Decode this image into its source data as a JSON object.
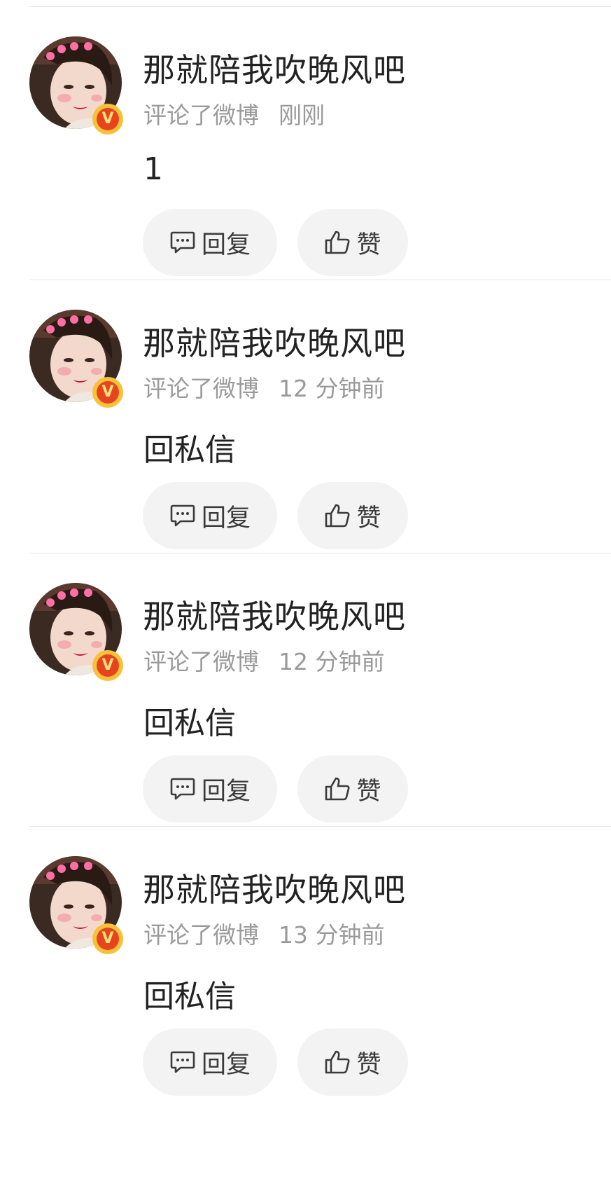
{
  "feed": {
    "items": [
      {
        "username": "那就陪我吹晚风吧",
        "action": "评论了微博",
        "time": "刚刚",
        "content": "1",
        "reply_label": "回复",
        "like_label": "赞",
        "badge": "V"
      },
      {
        "username": "那就陪我吹晚风吧",
        "action": "评论了微博",
        "time": "12 分钟前",
        "content": "回私信",
        "reply_label": "回复",
        "like_label": "赞",
        "badge": "V"
      },
      {
        "username": "那就陪我吹晚风吧",
        "action": "评论了微博",
        "time": "12 分钟前",
        "content": "回私信",
        "reply_label": "回复",
        "like_label": "赞",
        "badge": "V"
      },
      {
        "username": "那就陪我吹晚风吧",
        "action": "评论了微博",
        "time": "13 分钟前",
        "content": "回私信",
        "reply_label": "回复",
        "like_label": "赞",
        "badge": "V"
      }
    ]
  },
  "icons": {
    "reply": "comment-bubble-icon",
    "like": "thumbs-up-icon",
    "badge": "verified-v-icon"
  },
  "colors": {
    "badge_outer": "#f7c23a",
    "badge_inner": "#e8431f",
    "button_bg": "#f3f3f3",
    "meta_text": "#9a9a9a"
  }
}
